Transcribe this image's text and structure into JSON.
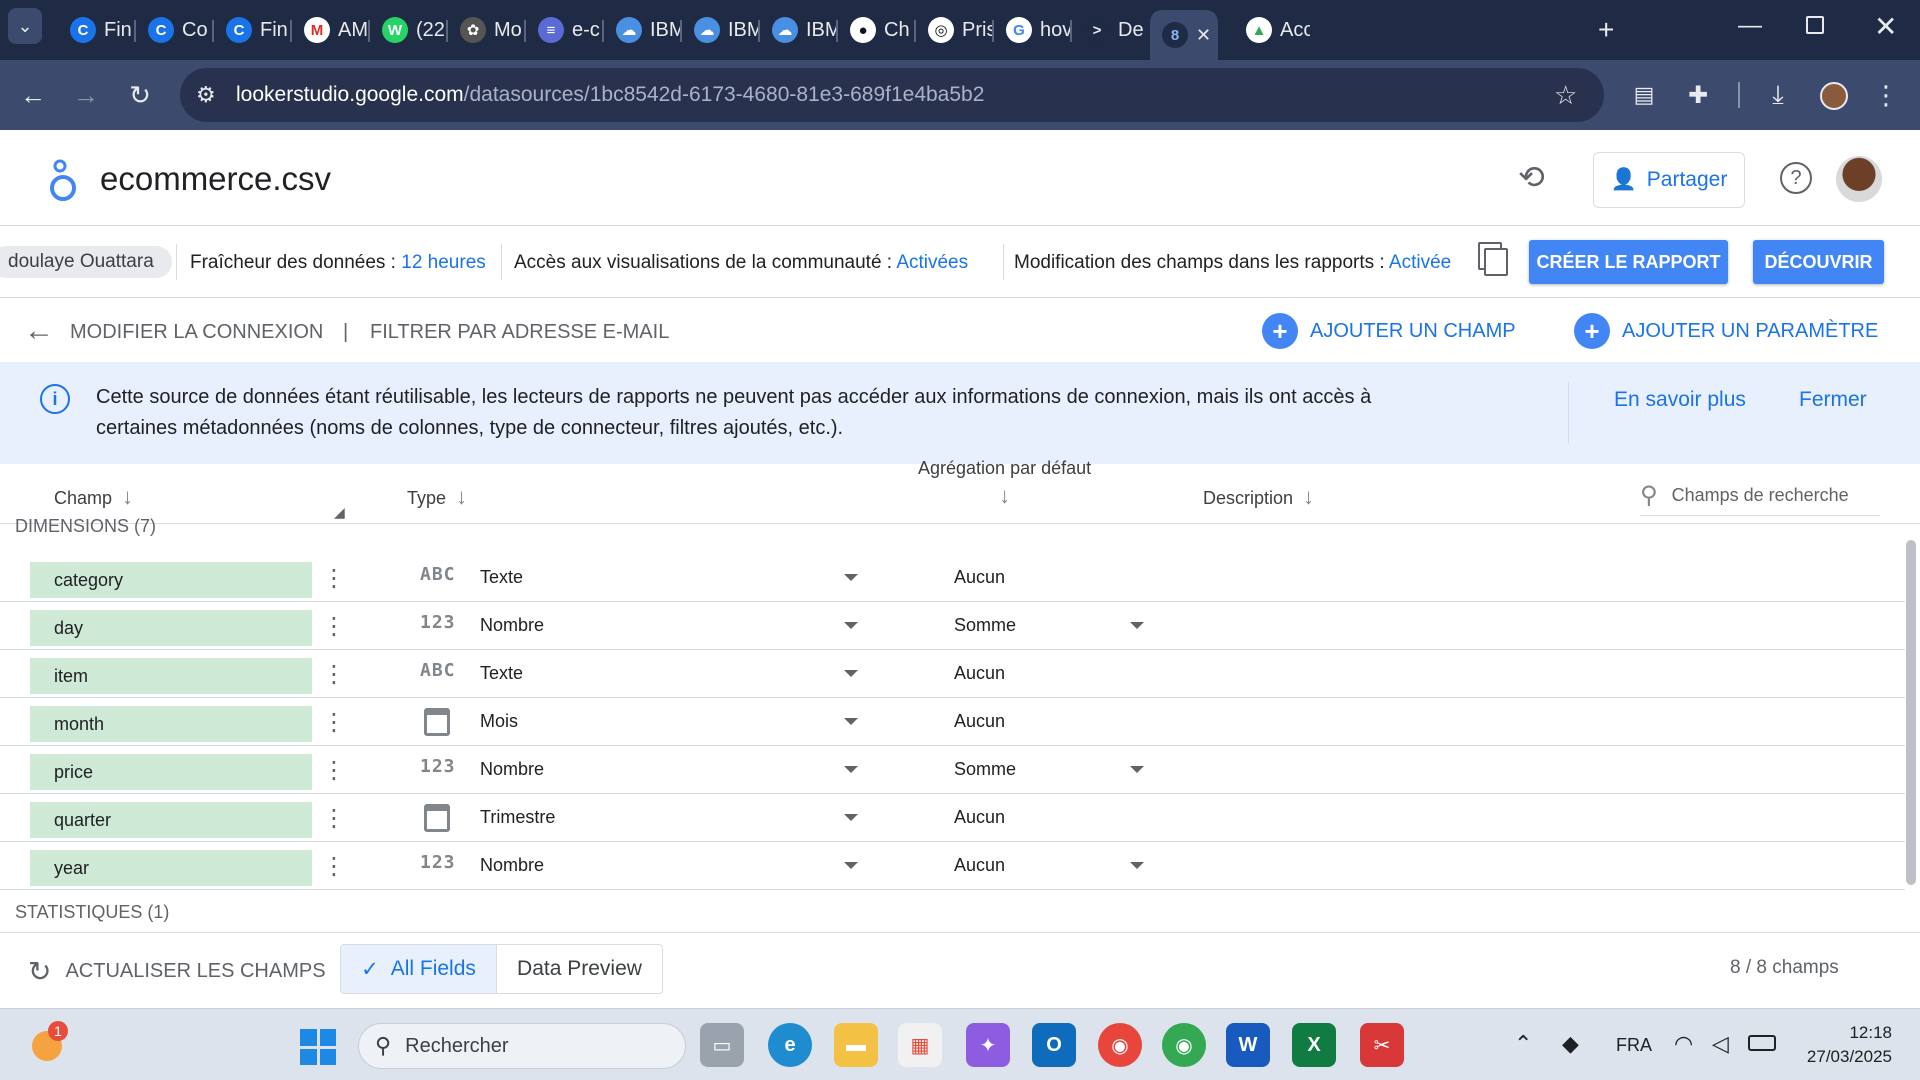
{
  "browser": {
    "tabs": [
      {
        "label": "Fin",
        "icon": "C"
      },
      {
        "label": "Co",
        "icon": "C"
      },
      {
        "label": "Fin",
        "icon": "C"
      },
      {
        "label": "AM",
        "icon": "M"
      },
      {
        "label": "(22",
        "icon": "W"
      },
      {
        "label": "Mo",
        "icon": "✿"
      },
      {
        "label": "e-c",
        "icon": "≡"
      },
      {
        "label": "IBM",
        "icon": "☁"
      },
      {
        "label": "IBM",
        "icon": "☁"
      },
      {
        "label": "IBM",
        "icon": "☁"
      },
      {
        "label": "Ch",
        "icon": "●"
      },
      {
        "label": "Pris",
        "icon": "◎"
      },
      {
        "label": "hov",
        "icon": "G"
      },
      {
        "label": "De",
        "icon": ">"
      },
      {
        "label": "",
        "icon": "8"
      },
      {
        "label": "Acc",
        "icon": "▲"
      }
    ],
    "url_host": "lookerstudio.google.com",
    "url_path": "/datasources/1bc8542d-6173-4680-81e3-689f1e4ba5b2"
  },
  "header": {
    "title": "ecommerce.csv",
    "share_label": "Partager"
  },
  "infobar": {
    "owner_chip": "doulaye Ouattara",
    "freshness_label": "Fraîcheur des données : ",
    "freshness_value": "12 heures",
    "community_label": "Accès aux visualisations de la communauté : ",
    "community_value": "Activées",
    "edit_label": "Modification des champs dans les rapports : ",
    "edit_value": "Activée",
    "create_report": "CRÉER LE RAPPORT",
    "discover": "DÉCOUVRIR"
  },
  "connbar": {
    "edit_connection": "MODIFIER LA CONNEXION",
    "separator": "|",
    "filter_email": "FILTRER PAR ADRESSE E-MAIL",
    "add_field": "AJOUTER UN CHAMP",
    "add_param": "AJOUTER UN PARAMÈTRE"
  },
  "banner": {
    "line1": "Cette source de données étant réutilisable, les lecteurs de rapports ne peuvent pas accéder aux informations de connexion, mais ils ont accès à",
    "line2": "certaines métadonnées (noms de colonnes, type de connecteur, filtres ajoutés, etc.).",
    "learn_more": "En savoir plus",
    "close": "Fermer"
  },
  "table": {
    "col_field": "Champ",
    "col_type": "Type",
    "col_agg": "Agrégation par défaut",
    "col_desc": "Description",
    "search_placeholder": "Champs de recherche",
    "dimensions_label": "DIMENSIONS (7)",
    "metrics_label": "STATISTIQUES (1)",
    "rows": [
      {
        "name": "category",
        "type_icon": "ABC",
        "type": "Texte",
        "agg": "Aucun",
        "agg_dropdown": false
      },
      {
        "name": "day",
        "type_icon": "123",
        "type": "Nombre",
        "agg": "Somme",
        "agg_dropdown": true
      },
      {
        "name": "item",
        "type_icon": "ABC",
        "type": "Texte",
        "agg": "Aucun",
        "agg_dropdown": false
      },
      {
        "name": "month",
        "type_icon": "calendar",
        "type": "Mois",
        "agg": "Aucun",
        "agg_dropdown": false
      },
      {
        "name": "price",
        "type_icon": "123",
        "type": "Nombre",
        "agg": "Somme",
        "agg_dropdown": true
      },
      {
        "name": "quarter",
        "type_icon": "calendar",
        "type": "Trimestre",
        "agg": "Aucun",
        "agg_dropdown": false
      },
      {
        "name": "year",
        "type_icon": "123",
        "type": "Nombre",
        "agg": "Aucun",
        "agg_dropdown": true
      }
    ]
  },
  "footer": {
    "refresh": "ACTUALISER LES CHAMPS",
    "tab_all": "All Fields",
    "tab_preview": "Data Preview",
    "count": "8 / 8 champs"
  },
  "taskbar": {
    "search": "Rechercher",
    "lang": "FRA",
    "time": "12:18",
    "date": "27/03/2025",
    "notif_badge": "1"
  },
  "colors": {
    "accent": "#1a73e8",
    "chip_green": "#ceead6",
    "banner": "#e8f0fe"
  }
}
